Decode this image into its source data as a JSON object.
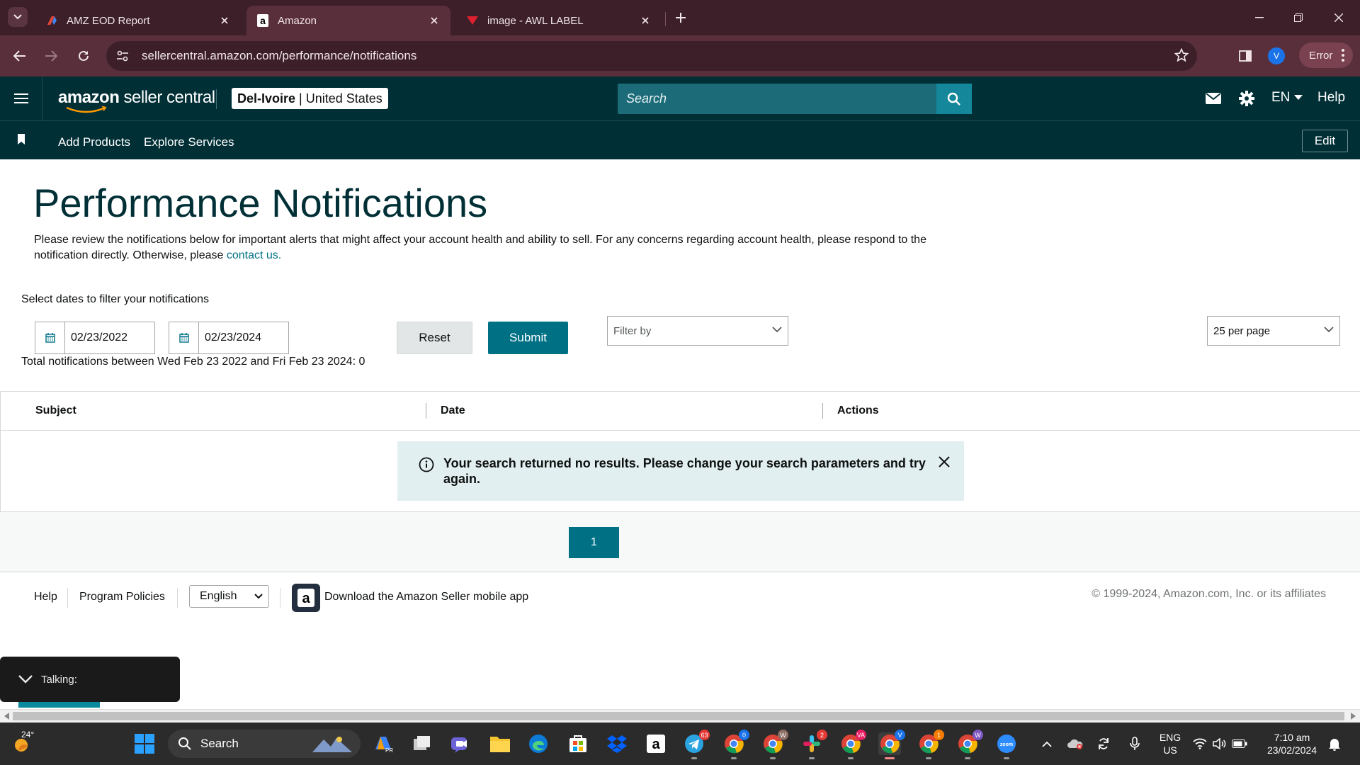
{
  "browser": {
    "tabs": [
      {
        "title": "AMZ EOD Report",
        "icon": "docs-icon"
      },
      {
        "title": "Amazon",
        "icon": "amazon-icon",
        "active": true
      },
      {
        "title": "image - AWL LABEL",
        "icon": "awl-icon"
      }
    ],
    "url": "sellercentral.amazon.com/performance/notifications",
    "profile_initial": "V",
    "error_label": "Error"
  },
  "header": {
    "logo_brand": "amazon",
    "logo_suffix": " seller central",
    "store_name": "Del-Ivoire",
    "store_region": "United States",
    "search_placeholder": "Search",
    "language": "EN",
    "help": "Help"
  },
  "subnav": {
    "items": [
      "Add Products",
      "Explore Services"
    ],
    "edit": "Edit"
  },
  "page": {
    "title": "Performance Notifications",
    "description": "Please review the notifications below for important alerts that might affect your account health and ability to sell. For any concerns regarding account health, please respond to the notification directly. Otherwise, please ",
    "contact_link": "contact us.",
    "date_label": "Select dates to filter your notifications",
    "date_from": "02/23/2022",
    "date_to": "02/23/2024",
    "reset": "Reset",
    "submit": "Submit",
    "filter_placeholder": "Filter by",
    "per_page": "25 per page",
    "total_text": "Total notifications between Wed Feb 23 2022 and Fri Feb 23 2024: 0"
  },
  "table": {
    "columns": [
      "Subject",
      "Date",
      "Actions"
    ],
    "empty_message": "Your search returned no results. Please change your search parameters and try again."
  },
  "pagination": {
    "current": "1"
  },
  "footer": {
    "help": "Help",
    "policies": "Program Policies",
    "language": "English",
    "app_text": "Download the Amazon Seller mobile app",
    "copyright": "© 1999-2024, Amazon.com, Inc. or its affiliates"
  },
  "talking_widget": {
    "label": "Talking:"
  },
  "taskbar": {
    "weather": "24°",
    "search": "Search",
    "lang_top": "ENG",
    "lang_bottom": "US",
    "time": "7:10 am",
    "date": "23/02/2024",
    "badges": {
      "telegram": "63",
      "chrome1": "0",
      "chrome2": "W",
      "slack": "2",
      "chrome3": "VA",
      "chrome4": "V",
      "chrome5": "1",
      "chrome6": "W"
    }
  },
  "colors": {
    "header_bg": "#002f36",
    "accent": "#007185",
    "browser_frame": "#3c1f28",
    "alert_bg": "#e2eff1"
  }
}
